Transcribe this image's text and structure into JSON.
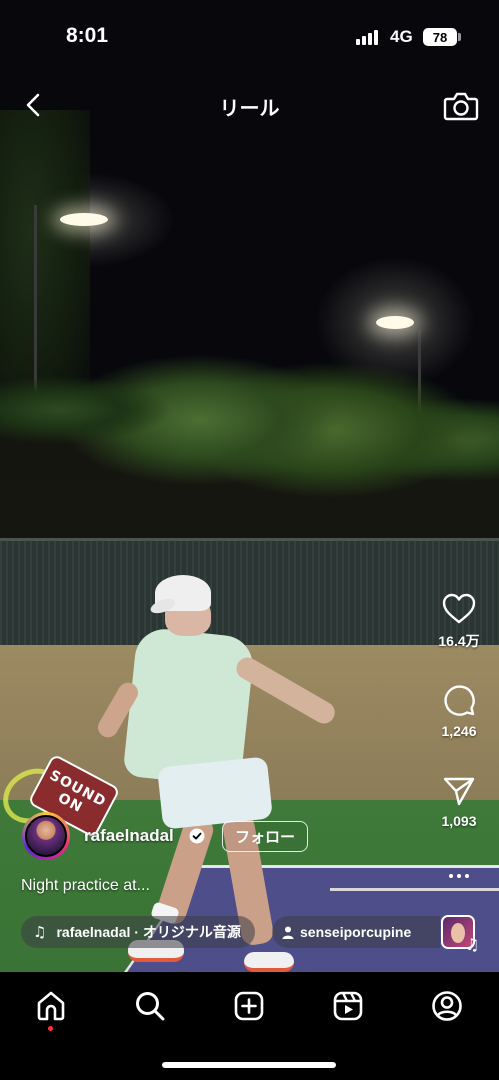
{
  "status_bar": {
    "time": "8:01",
    "network": "4G",
    "battery": "78"
  },
  "header": {
    "title": "リール",
    "back_icon": "chevron-left-icon",
    "camera_icon": "camera-icon"
  },
  "actions": {
    "like_count": "16.4万",
    "comment_count": "1,246",
    "share_count": "1,093"
  },
  "overlay": {
    "sticker_line1": "SOUND",
    "sticker_line2": "ON"
  },
  "post": {
    "username": "rafaelnadal",
    "follow_label": "フォロー",
    "caption": "Night practice at...",
    "audio_label": "rafaelnadal · オリジナル音源",
    "collab_label": "senseiporcupine"
  },
  "bottom_nav": {
    "items": [
      "home-icon",
      "search-icon",
      "create-icon",
      "reels-icon",
      "profile-icon"
    ]
  },
  "colors": {
    "accent_notification": "#ff3040",
    "text": "#ffffff",
    "background": "#000000"
  }
}
